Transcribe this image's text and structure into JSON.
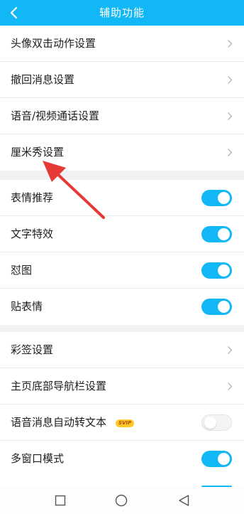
{
  "header": {
    "title": "辅助功能",
    "back_icon": "chevron-left-icon"
  },
  "group1": {
    "items": [
      {
        "label": "头像双击动作设置"
      },
      {
        "label": "撤回消息设置"
      },
      {
        "label": "语音/视频通话设置"
      },
      {
        "label": "厘米秀设置"
      }
    ]
  },
  "group2": {
    "items": [
      {
        "label": "表情推荐",
        "enabled": true
      },
      {
        "label": "文字特效",
        "enabled": true
      },
      {
        "label": "怼图",
        "enabled": true
      },
      {
        "label": "贴表情",
        "enabled": true
      }
    ]
  },
  "group3": {
    "items": [
      {
        "label": "彩签设置"
      },
      {
        "label": "主页底部导航栏设置"
      },
      {
        "label": "语音消息自动转文本",
        "badge": "SVIP",
        "enabled": false
      },
      {
        "label": "多窗口模式",
        "enabled": true
      }
    ]
  },
  "navbar": {
    "icons": [
      "recents-square-icon",
      "home-circle-icon",
      "back-triangle-icon"
    ]
  },
  "colors": {
    "accent": "#12b7f5",
    "annotation_arrow": "#e53935",
    "svip_badge": "#ffca28"
  }
}
